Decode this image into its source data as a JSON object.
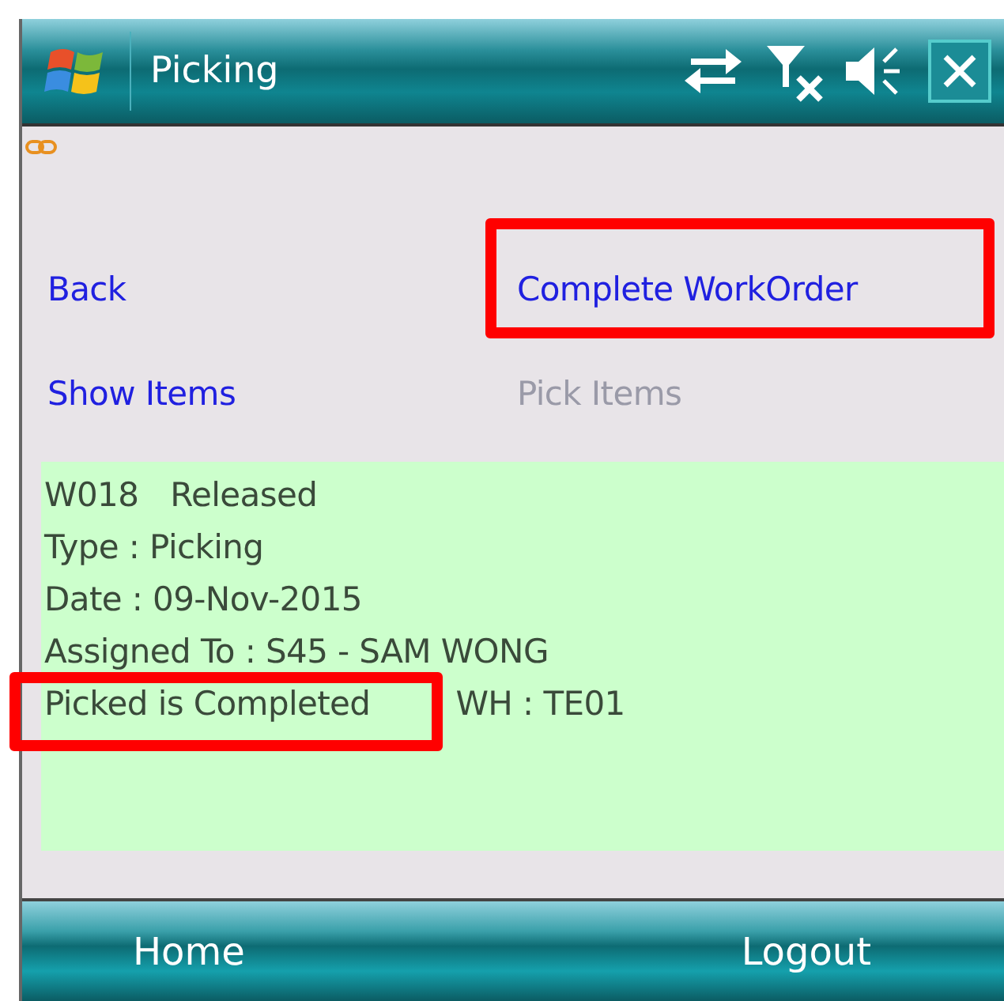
{
  "title_bar": {
    "title": "Picking"
  },
  "links": [
    {
      "label": "Back",
      "disabled": false,
      "highlighted": false
    },
    {
      "label": "Complete WorkOrder",
      "disabled": false,
      "highlighted": true
    },
    {
      "label": "Show Items",
      "disabled": false,
      "highlighted": false
    },
    {
      "label": "Pick Items",
      "disabled": true,
      "highlighted": false
    }
  ],
  "info_panel": {
    "lines": [
      {
        "parts": [
          {
            "text": "W018",
            "highlighted": false
          },
          {
            "text": "Released",
            "highlighted": false
          }
        ]
      },
      {
        "parts": [
          {
            "text": "Type : Picking",
            "highlighted": false
          }
        ]
      },
      {
        "parts": [
          {
            "text": "Date : 09-Nov-2015",
            "highlighted": false
          }
        ]
      },
      {
        "parts": [
          {
            "text": "Assigned To : S45 - SAM WONG",
            "highlighted": false
          }
        ]
      },
      {
        "parts": [
          {
            "text": "Picked is Completed",
            "highlighted": true
          },
          {
            "text": "WH : TE01",
            "highlighted": false
          }
        ]
      }
    ]
  },
  "soft_keys": [
    {
      "label": "Home"
    },
    {
      "label": "Logout"
    }
  ]
}
